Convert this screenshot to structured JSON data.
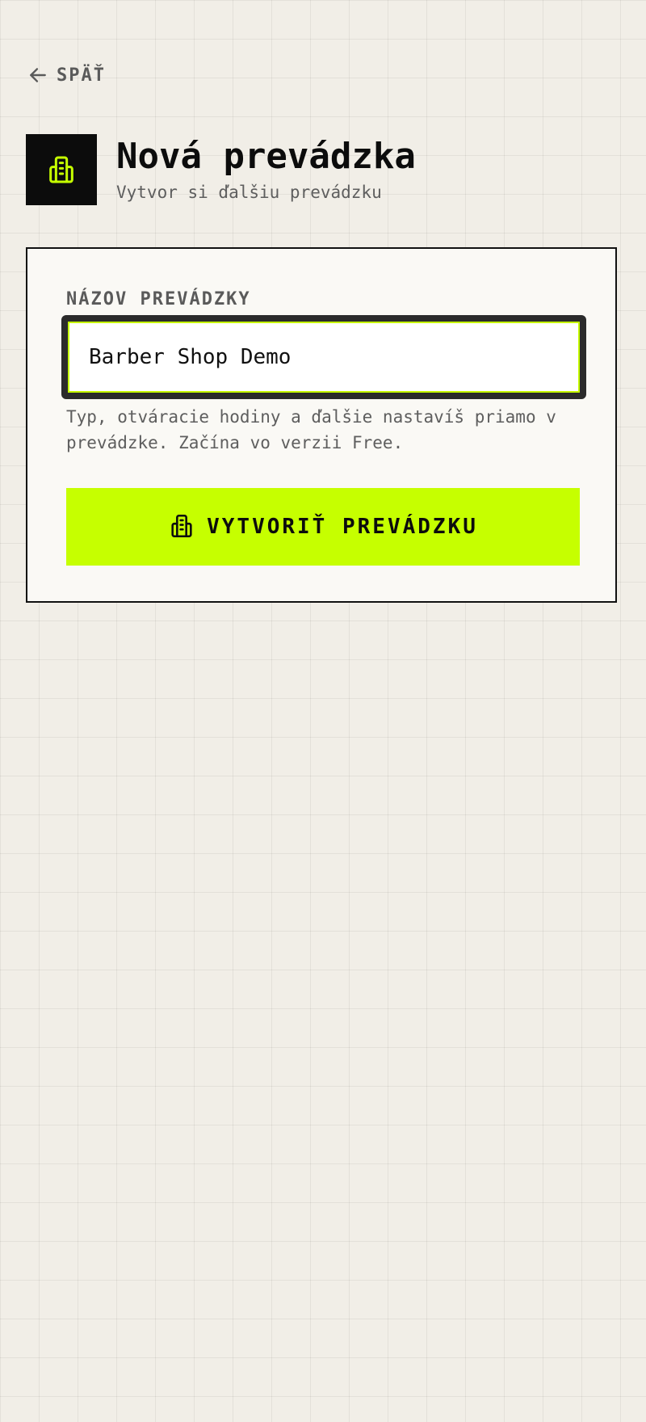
{
  "nav": {
    "back_label": "SPÄŤ",
    "back_icon": "arrow-left-icon"
  },
  "header": {
    "icon": "building-icon",
    "title": "Nová prevádzka",
    "subtitle": "Vytvor si ďalšiu prevádzku"
  },
  "form": {
    "name_label": "NÁZOV PREVÁDZKY",
    "name_value": "Barber Shop Demo",
    "helper_text": "Typ, otváracie hodiny a ďalšie nastavíš priamo v prevádzke. Začína vo verzii Free.",
    "submit_icon": "building-icon",
    "submit_label": "VYTVORIŤ PREVÁDZKU"
  },
  "colors": {
    "accent": "#c6ff00",
    "dark": "#0c0c0c",
    "background": "#f1eee7",
    "card": "#faf9f5"
  }
}
